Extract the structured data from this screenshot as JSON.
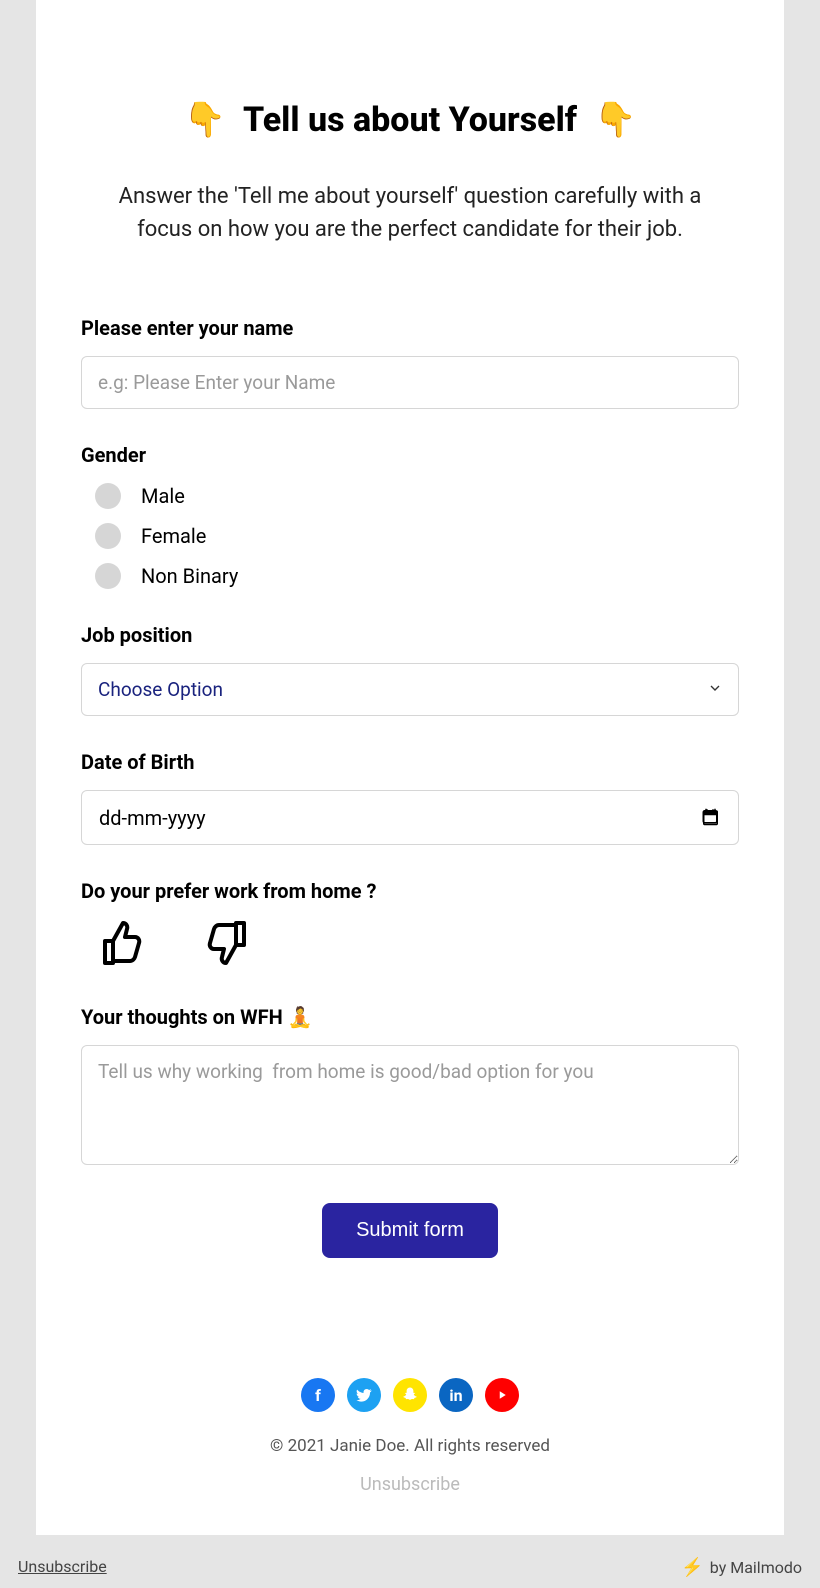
{
  "header": {
    "emoji_left": "👇",
    "title": "Tell us about Yourself",
    "emoji_right": "👇"
  },
  "intro": "Answer the 'Tell me about yourself' question carefully with a focus on how you are the perfect candidate for their job.",
  "name": {
    "label": "Please enter your name",
    "placeholder": "e.g: Please Enter your Name"
  },
  "gender": {
    "label": "Gender",
    "options": [
      "Male",
      "Female",
      "Non Binary"
    ]
  },
  "job": {
    "label": "Job position",
    "placeholder": "Choose Option"
  },
  "dob": {
    "label": "Date of Birth",
    "placeholder": "dd-mm-yyyy"
  },
  "wfh_pref": {
    "label": "Do your prefer work from home ?"
  },
  "wfh_thoughts": {
    "label": "Your thoughts on WFH 🧘",
    "placeholder": "Tell us why working  from home is good/bad option for you"
  },
  "submit": "Submit form",
  "footer": {
    "copyright": "© 2021 Janie Doe. All rights reserved",
    "unsubscribe": "Unsubscribe"
  },
  "bottombar": {
    "unsubscribe": "Unsubscribe",
    "by": "by Mailmodo"
  }
}
